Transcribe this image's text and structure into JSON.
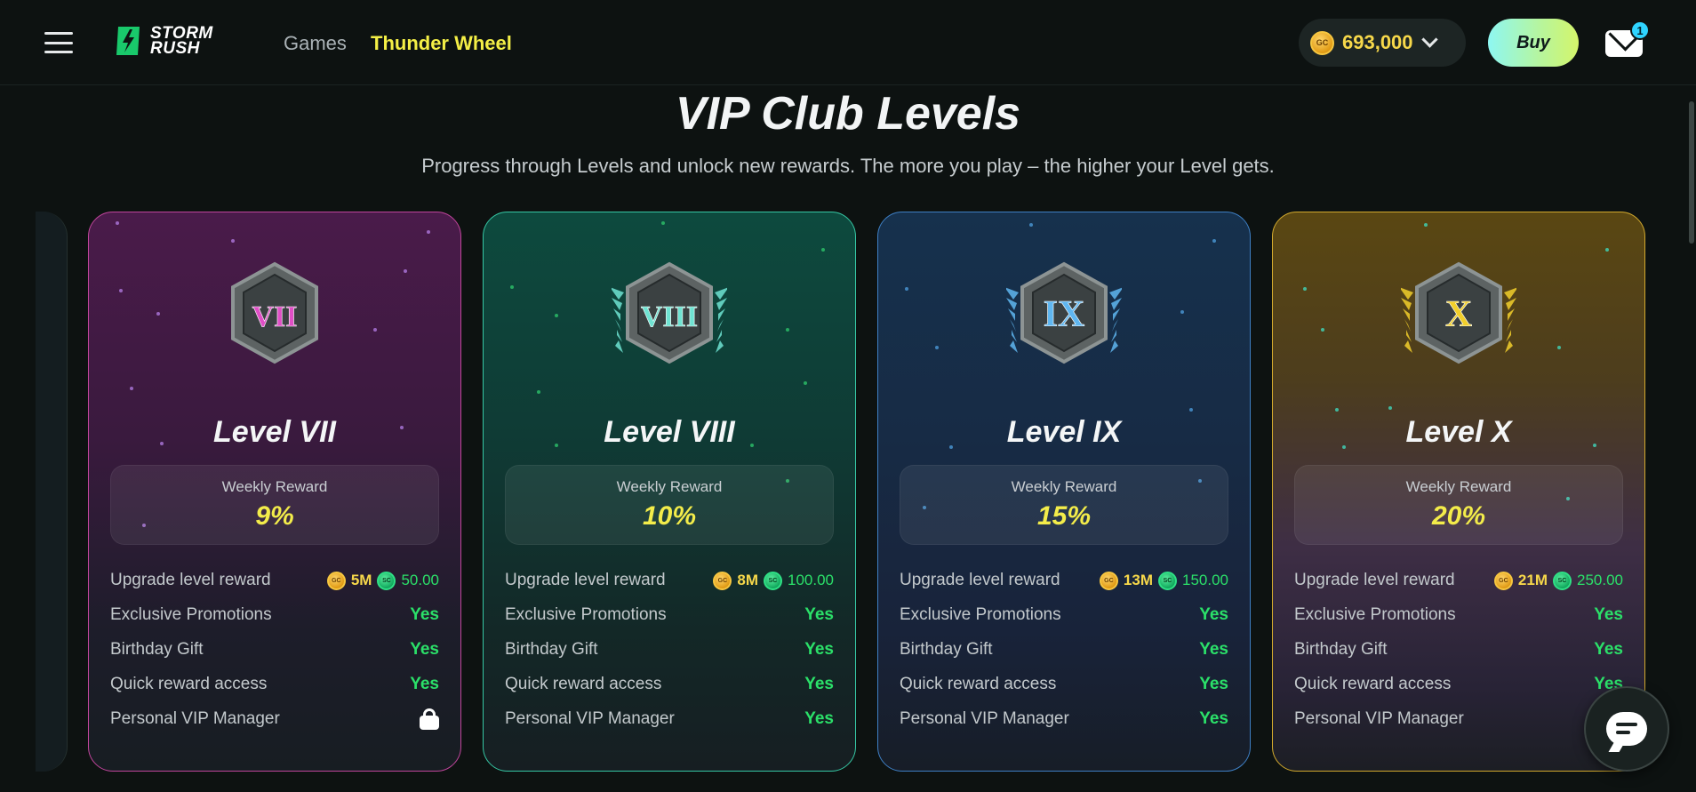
{
  "header": {
    "logo_line1": "STORM",
    "logo_line2": "RUSH",
    "nav_games": "Games",
    "nav_wheel": "Thunder Wheel",
    "balance": "693,000",
    "currency_icon": "gc-coin-icon",
    "buy_label": "Buy",
    "mail_count": "1"
  },
  "page": {
    "title": "VIP Club Levels",
    "subtitle": "Progress through Levels and unlock new rewards. The more you play – the higher your Level gets."
  },
  "labels": {
    "weekly_reward": "Weekly Reward",
    "upgrade": "Upgrade level reward",
    "promotions": "Exclusive Promotions",
    "birthday": "Birthday Gift",
    "quick": "Quick reward access",
    "manager": "Personal VIP Manager",
    "yes": "Yes"
  },
  "levels": [
    {
      "numeral": "VII",
      "name": "Level VII",
      "weekly": "9%",
      "gc": "5M",
      "sc": "50.00",
      "promotions": "Yes",
      "birthday": "Yes",
      "quick": "Yes",
      "manager": "locked",
      "accent": "#e04fc6"
    },
    {
      "numeral": "VIII",
      "name": "Level VIII",
      "weekly": "10%",
      "gc": "8M",
      "sc": "100.00",
      "promotions": "Yes",
      "birthday": "Yes",
      "quick": "Yes",
      "manager": "Yes",
      "accent": "#6fe3d2"
    },
    {
      "numeral": "IX",
      "name": "Level IX",
      "weekly": "15%",
      "gc": "13M",
      "sc": "150.00",
      "promotions": "Yes",
      "birthday": "Yes",
      "quick": "Yes",
      "manager": "Yes",
      "accent": "#5fb6f0"
    },
    {
      "numeral": "X",
      "name": "Level X",
      "weekly": "20%",
      "gc": "21M",
      "sc": "250.00",
      "promotions": "Yes",
      "birthday": "Yes",
      "quick": "Yes",
      "manager": "",
      "accent": "#f2cf2b"
    }
  ]
}
